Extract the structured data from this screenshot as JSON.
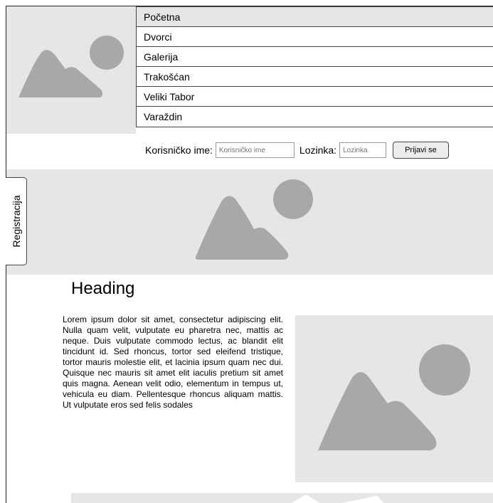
{
  "nav": {
    "items": [
      "Početna",
      "Dvorci",
      "Galerija",
      "Trakošćan",
      "Veliki Tabor",
      "Varaždin"
    ],
    "active_index": 0
  },
  "login": {
    "username_label": "Korisničko ime:",
    "username_placeholder": "Korisničko ime",
    "password_label": "Lozinka:",
    "password_placeholder": "Lozinka",
    "submit_label": "Prijavi se"
  },
  "side_tab": {
    "label": "Registracija"
  },
  "main": {
    "heading": "Heading",
    "body": "Lorem ipsum dolor sit amet, consectetur adipiscing elit. Nulla quam velit, vulputate eu pharetra nec, mattis ac neque. Duis vulputate commodo lectus, ac blandit elit tincidunt id. Sed rhoncus, tortor sed eleifend tristique, tortor mauris molestie elit, et lacinia ipsum quam nec dui. Quisque nec mauris sit amet elit iaculis pretium sit amet quis magna. Aenean velit odio, elementum in tempus ut, vehicula eu diam. Pellentesque rhoncus aliquam mattis. Ut vulputate eros sed felis sodales"
  },
  "colors": {
    "placeholder_bg": "#e6e6e6",
    "placeholder_shape": "#a8a8a8"
  }
}
